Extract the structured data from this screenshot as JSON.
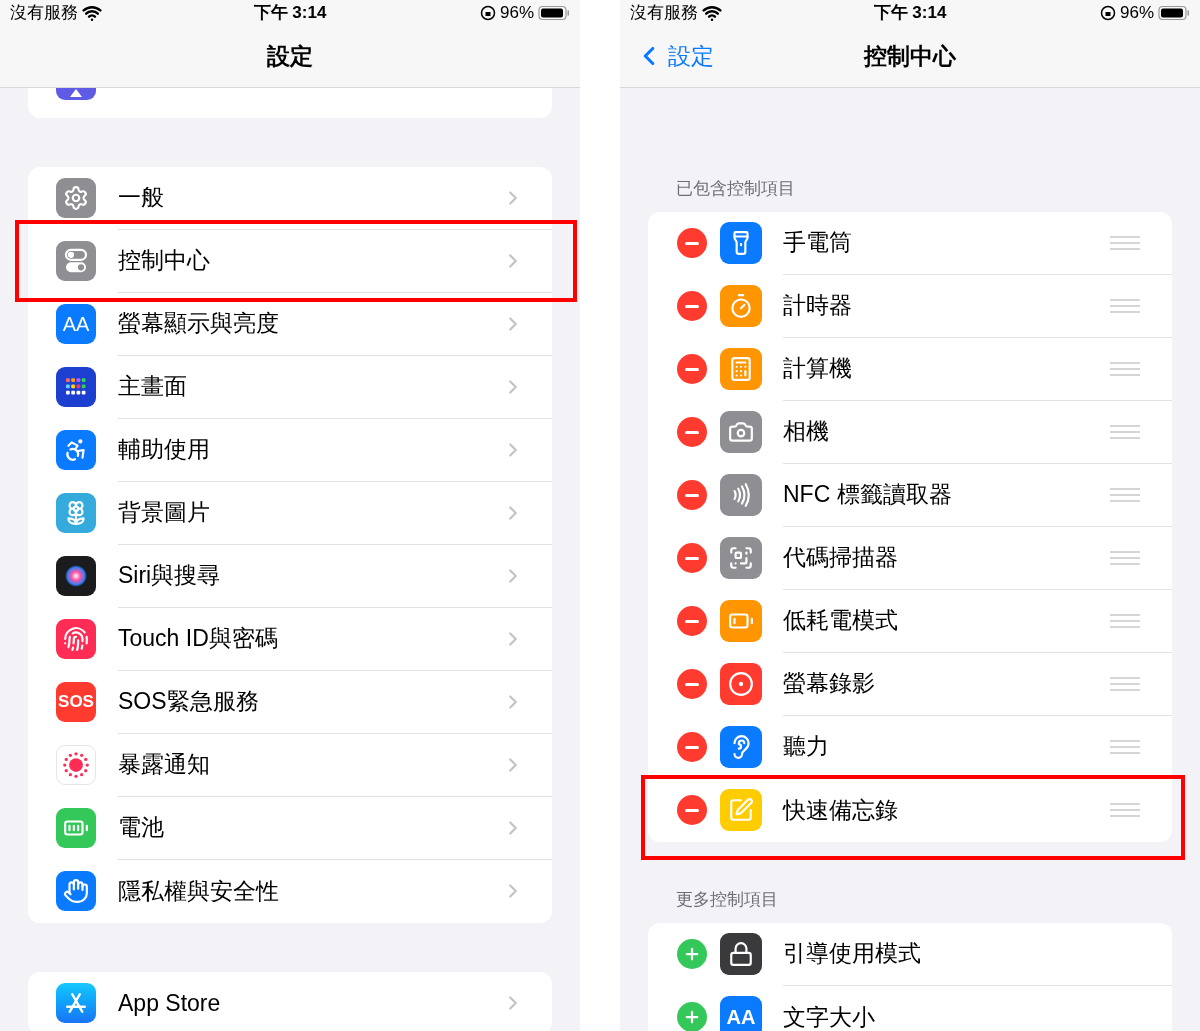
{
  "left_panel": {
    "status_bar": {
      "carrier": "沒有服務",
      "time": "下午 3:14",
      "battery": "96%"
    },
    "nav": {
      "title": "設定"
    },
    "groups": [
      {
        "items": [
          {
            "label": "一般",
            "highlighted": false
          },
          {
            "label": "控制中心",
            "highlighted": true
          },
          {
            "label": "螢幕顯示與亮度",
            "icon_text": "AA",
            "highlighted": false
          },
          {
            "label": "主畫面",
            "highlighted": false
          },
          {
            "label": "輔助使用",
            "highlighted": false
          },
          {
            "label": "背景圖片",
            "highlighted": false
          },
          {
            "label": "Siri與搜尋",
            "highlighted": false
          },
          {
            "label": "Touch ID與密碼",
            "highlighted": false
          },
          {
            "label": "SOS緊急服務",
            "icon_text": "SOS",
            "highlighted": false
          },
          {
            "label": "暴露通知",
            "highlighted": false
          },
          {
            "label": "電池",
            "highlighted": false
          },
          {
            "label": "隱私權與安全性",
            "highlighted": false
          }
        ]
      },
      {
        "items": [
          {
            "label": "App Store",
            "highlighted": false
          }
        ]
      }
    ]
  },
  "right_panel": {
    "status_bar": {
      "carrier": "沒有服務",
      "time": "下午 3:14",
      "battery": "96%"
    },
    "nav": {
      "back": "設定",
      "title": "控制中心"
    },
    "sections": [
      {
        "header": "已包含控制項目",
        "items": [
          {
            "label": "手電筒",
            "included": true,
            "highlighted": false
          },
          {
            "label": "計時器",
            "included": true,
            "highlighted": false
          },
          {
            "label": "計算機",
            "included": true,
            "highlighted": false
          },
          {
            "label": "相機",
            "included": true,
            "highlighted": false
          },
          {
            "label": "NFC 標籤讀取器",
            "included": true,
            "highlighted": false
          },
          {
            "label": "代碼掃描器",
            "included": true,
            "highlighted": false
          },
          {
            "label": "低耗電模式",
            "included": true,
            "highlighted": false
          },
          {
            "label": "螢幕錄影",
            "included": true,
            "highlighted": false
          },
          {
            "label": "聽力",
            "included": true,
            "highlighted": false
          },
          {
            "label": "快速備忘錄",
            "included": true,
            "highlighted": true
          }
        ]
      },
      {
        "header": "更多控制項目",
        "items": [
          {
            "label": "引導使用模式",
            "included": false,
            "highlighted": false
          },
          {
            "label": "文字大小",
            "icon_text": "AA",
            "included": false,
            "highlighted": false
          }
        ]
      }
    ]
  }
}
